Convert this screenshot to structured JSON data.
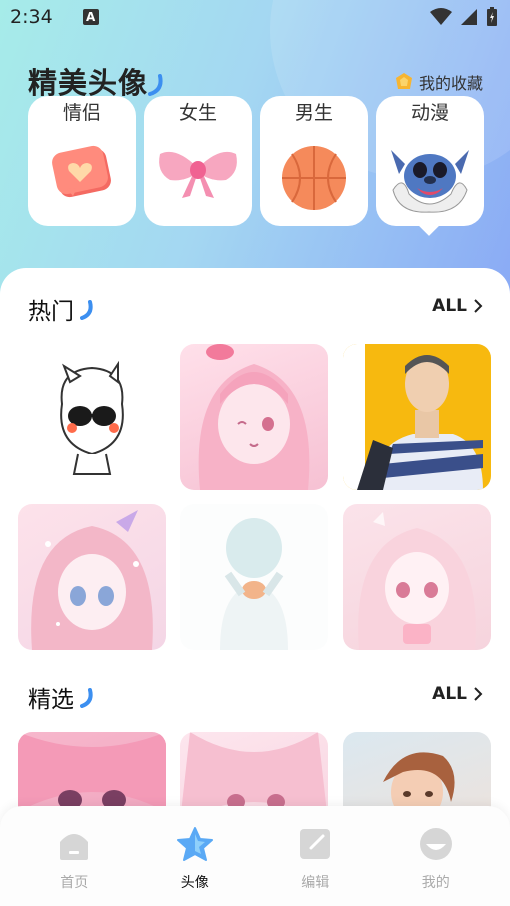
{
  "status": {
    "time": "2:34",
    "a_icon": "A"
  },
  "header": {
    "title": "精美头像",
    "favorites_label": "我的收藏"
  },
  "categories": [
    {
      "label": "情侣",
      "icon": "heart-badge-icon"
    },
    {
      "label": "女生",
      "icon": "pink-bow-icon"
    },
    {
      "label": "男生",
      "icon": "basketball-icon"
    },
    {
      "label": "动漫",
      "icon": "stitch-cartoon-icon"
    }
  ],
  "sections": {
    "hot": {
      "title": "热门",
      "all_label": "ALL"
    },
    "featured": {
      "title": "精选",
      "all_label": "ALL"
    }
  },
  "bottom_nav": [
    {
      "label": "首页",
      "icon": "home-icon"
    },
    {
      "label": "头像",
      "icon": "star-icon"
    },
    {
      "label": "编辑",
      "icon": "edit-icon"
    },
    {
      "label": "我的",
      "icon": "profile-icon"
    }
  ],
  "colors": {
    "hero_start": "#a6ece9",
    "hero_end": "#8aaaf5",
    "accent_blue": "#3c8ff0",
    "star_blue": "#5aa9f5"
  }
}
